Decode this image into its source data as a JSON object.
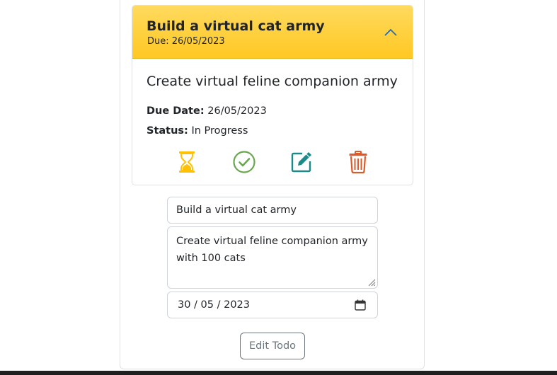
{
  "todo": {
    "title": "Build a virtual cat army",
    "due_header": "Due: 26/05/2023",
    "description": "Create virtual feline companion army",
    "due_label": "Due Date:",
    "due_value": "26/05/2023",
    "status_label": "Status:",
    "status_value": "In Progress"
  },
  "actions": [
    {
      "icon": "hourglass-icon",
      "color": "#ffc107"
    },
    {
      "icon": "check-circle-icon",
      "color": "#6aa84f"
    },
    {
      "icon": "edit-icon",
      "color": "#1a8a8a"
    },
    {
      "icon": "trash-icon",
      "color": "#dc5a2a"
    }
  ],
  "form": {
    "title_value": "Build a virtual cat army",
    "description_value": "Create virtual feline companion army with 100 cats",
    "date_value": "30 / 05 / 2023",
    "submit_label": "Edit Todo"
  },
  "colors": {
    "header_bg": "#ffc823",
    "accent_outline": "#6c757d"
  }
}
